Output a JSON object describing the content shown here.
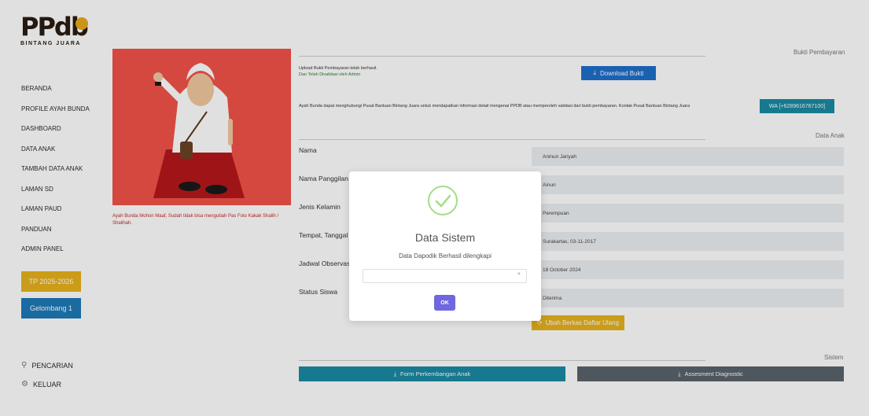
{
  "logo": {
    "main": "PPdb",
    "sub": "BINTANG JUARA"
  },
  "nav": [
    "BERANDA",
    "PROFILE AYAH BUNDA",
    "DASHBOARD",
    "DATA ANAK",
    "TAMBAH DATA ANAK",
    "LAMAN SD",
    "LAMAN PAUD",
    "PANDUAN",
    "ADMIN PANEL"
  ],
  "sidebar": {
    "tp": "TP 2025-2026",
    "gelombang": "Gelombang 1",
    "pencarian": "PENCARIAN",
    "keluar": "KELUAR"
  },
  "photo_note": "Ayah Bunda Mohon Maaf, Sudah tidak bisa mengubah Pas Foto Kakak Shalih / Shalihah.",
  "bukti": {
    "title": "Bukti Pembayaran",
    "upload_line1": "Upload Bukti Pembayaran telah berhasil.",
    "upload_line2": "Dan Telah Divalidasi oleh Admin",
    "download": "Download Bukti",
    "info": "Ayah Bunda dapat menghubungi Pusat Bantuan Bintang Juara untuk mendapatkan informasi detail mengenai PPDB atau memperoleh validasi dari bukti pembayaran. Kontak Pusat Bantuan Bintang Juara",
    "wa": "WA [+6289616767100]"
  },
  "data_anak": {
    "title": "Data Anak",
    "fields": [
      {
        "label": "Nama",
        "value": "Aninun Jariyah"
      },
      {
        "label": "Nama Panggilan",
        "value": "Ainun"
      },
      {
        "label": "Jenis Kelamin",
        "value": "Perempuan"
      },
      {
        "label": "Tempat, Tanggal l",
        "value": "Surakartas, 03-11-2017"
      },
      {
        "label": "Jadwal Observasi",
        "value": "18 October 2024"
      },
      {
        "label": "Status Siswa",
        "value": "Diterima"
      }
    ],
    "ubah": "Ubah Berkas Daftar Ulang"
  },
  "sistem": {
    "title": "Sistem",
    "form": "Form Perkembangan Anak",
    "asesmen": "Assesment Diagnostic"
  },
  "modal": {
    "title": "Data Sistem",
    "text": "Data Dapodik Berhasil dilengkapi",
    "select_value": "",
    "ok": "OK"
  },
  "colors": {
    "accent_yellow": "#e7b21c",
    "accent_blue": "#1d7ab8",
    "teal": "#1a8aa3",
    "modal_ok": "#7066e0"
  }
}
